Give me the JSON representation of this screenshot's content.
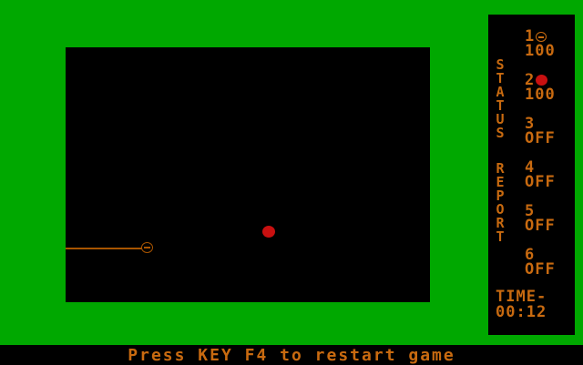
{
  "status_title_1": "STATUS",
  "status_title_2": "REPORT",
  "players": [
    {
      "number": "1",
      "icon": "player-ball-icon",
      "value": "100"
    },
    {
      "number": "2",
      "icon": "red-ball-icon",
      "value": "100"
    },
    {
      "number": "3",
      "value": "OFF"
    },
    {
      "number": "4",
      "value": "OFF"
    },
    {
      "number": "5",
      "value": "OFF"
    },
    {
      "number": "6",
      "value": "OFF"
    }
  ],
  "timer": {
    "label": "TIME-",
    "value": "00:12"
  },
  "footer_message": "Press KEY F4 to restart game",
  "colors": {
    "field": "#00a800",
    "text": "#c86a10",
    "red": "#c81010"
  }
}
